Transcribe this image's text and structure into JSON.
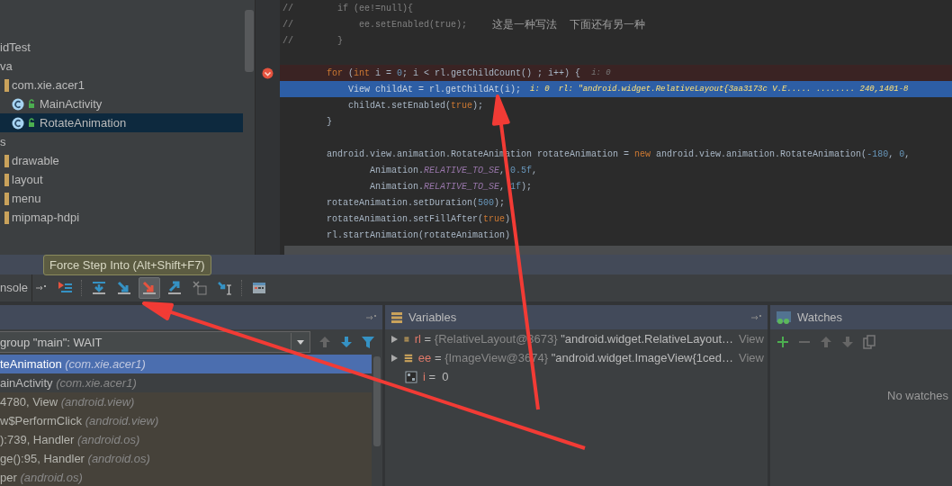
{
  "project_tree": [
    {
      "label": "idTest",
      "selected": false
    },
    {
      "label": "va",
      "selected": false,
      "children": [
        {
          "label": "com.xie.acer1",
          "kind": "folder",
          "selected": false,
          "children": [
            {
              "label": "MainActivity",
              "kind": "class",
              "selected": false
            },
            {
              "label": "RotateAnimation",
              "kind": "class",
              "selected": true
            }
          ]
        }
      ]
    },
    {
      "label": "s",
      "selected": false,
      "children": [
        {
          "label": "drawable",
          "kind": "folder",
          "selected": false
        },
        {
          "label": "layout",
          "kind": "folder",
          "selected": false
        },
        {
          "label": "menu",
          "kind": "folder",
          "selected": false
        },
        {
          "label": "mipmap-hdpi",
          "kind": "folder",
          "selected": false
        }
      ]
    }
  ],
  "editor": {
    "lines": [
      {
        "kind": "code",
        "prefix": "//",
        "breakpoint": false,
        "execution_point": false,
        "segments": [
          {
            "text": "  if (ee!=null){",
            "kind": "comment"
          }
        ]
      },
      {
        "kind": "code",
        "prefix": "//",
        "breakpoint": false,
        "execution_point": false,
        "segments": [
          {
            "text": "      ee.setEnabled(true);",
            "kind": "comment"
          },
          {
            "text": "这是一种写法",
            "kind": "note"
          },
          {
            "text": "下面还有另一种",
            "kind": "note"
          }
        ]
      },
      {
        "kind": "code",
        "prefix": "//",
        "breakpoint": false,
        "execution_point": false,
        "segments": [
          {
            "text": "  }",
            "kind": "comment"
          }
        ]
      },
      {
        "kind": "blank"
      },
      {
        "kind": "code",
        "breakpoint": true,
        "execution_point": false,
        "segments": [
          {
            "text": "for",
            "kind": "keyword"
          },
          {
            "text": " (",
            "kind": "plain"
          },
          {
            "text": "int",
            "kind": "keyword"
          },
          {
            "text": " i = ",
            "kind": "plain"
          },
          {
            "text": "0",
            "kind": "number"
          },
          {
            "text": "; i < rl.getChildCount() ; i++) {",
            "kind": "plain"
          },
          {
            "text": "i: 0",
            "kind": "hint"
          }
        ]
      },
      {
        "kind": "code",
        "breakpoint": false,
        "execution_point": true,
        "segments": [
          {
            "text": "    View childAt = rl.getChildAt(i);",
            "kind": "plain"
          },
          {
            "text": "i: 0",
            "kind": "hint"
          },
          {
            "text": "rl: \"android.widget.RelativeLayout{3aa3173c V.E..... ........ 240,1401-8",
            "kind": "hint"
          }
        ]
      },
      {
        "kind": "code",
        "breakpoint": false,
        "execution_point": false,
        "segments": [
          {
            "text": "    childAt.setEnabled(",
            "kind": "plain"
          },
          {
            "text": "true",
            "kind": "keyword"
          },
          {
            "text": ");",
            "kind": "plain"
          }
        ]
      },
      {
        "kind": "code",
        "breakpoint": false,
        "execution_point": false,
        "segments": [
          {
            "text": "}",
            "kind": "plain"
          }
        ]
      },
      {
        "kind": "blank"
      },
      {
        "kind": "code",
        "breakpoint": false,
        "execution_point": false,
        "segments": [
          {
            "text": "android.view.animation.RotateAnimation rotateAnimation = ",
            "kind": "plain"
          },
          {
            "text": "new",
            "kind": "keyword"
          },
          {
            "text": " android.view.animation.RotateAnimation(",
            "kind": "plain"
          },
          {
            "text": "-180",
            "kind": "number"
          },
          {
            "text": ", ",
            "kind": "plain"
          },
          {
            "text": "0",
            "kind": "number"
          },
          {
            "text": ",",
            "kind": "plain"
          }
        ]
      },
      {
        "kind": "code",
        "breakpoint": false,
        "execution_point": false,
        "segments": [
          {
            "text": "        Animation.",
            "kind": "plain"
          },
          {
            "text": "RELATIVE_TO_SE",
            "kind": "const"
          },
          {
            "text": ", ",
            "kind": "plain"
          },
          {
            "text": "0.5f",
            "kind": "number"
          },
          {
            "text": ",",
            "kind": "plain"
          }
        ]
      },
      {
        "kind": "code",
        "breakpoint": false,
        "execution_point": false,
        "segments": [
          {
            "text": "        Animation.",
            "kind": "plain"
          },
          {
            "text": "RELATIVE_TO_SE",
            "kind": "const"
          },
          {
            "text": ", ",
            "kind": "plain"
          },
          {
            "text": "1f",
            "kind": "number"
          },
          {
            "text": ");",
            "kind": "plain"
          }
        ]
      },
      {
        "kind": "code",
        "breakpoint": false,
        "execution_point": false,
        "segments": [
          {
            "text": "rotateAnimation.setDuration(",
            "kind": "plain"
          },
          {
            "text": "500",
            "kind": "number"
          },
          {
            "text": ");",
            "kind": "plain"
          }
        ]
      },
      {
        "kind": "code",
        "breakpoint": false,
        "execution_point": false,
        "segments": [
          {
            "text": "rotateAnimation.setFillAfter(",
            "kind": "plain"
          },
          {
            "text": "true",
            "kind": "keyword"
          },
          {
            "text": ")",
            "kind": "plain"
          }
        ]
      },
      {
        "kind": "code",
        "breakpoint": false,
        "execution_point": false,
        "segments": [
          {
            "text": "rl.startAnimation(rotateAnimation)",
            "kind": "plain"
          }
        ]
      }
    ]
  },
  "tooltip": "Force Step Into (Alt+Shift+F7)",
  "debug_toolbar": {
    "tab": "nsole",
    "buttons": [
      {
        "kind": "show-execution-point",
        "pressed": false
      },
      {
        "kind": "step-over",
        "pressed": false
      },
      {
        "kind": "step-into",
        "pressed": false
      },
      {
        "kind": "force-step-into",
        "pressed": true
      },
      {
        "kind": "step-out",
        "pressed": false
      },
      {
        "kind": "drop-frame",
        "pressed": false
      },
      {
        "kind": "run-to-cursor",
        "pressed": false
      },
      {
        "kind": "evaluate",
        "pressed": false
      }
    ]
  },
  "frames": {
    "thread": "group \"main\": WAIT",
    "items": [
      {
        "method": "teAnimation",
        "package": "(com.xie.acer1)",
        "selected": true,
        "library": false
      },
      {
        "method": "ainActivity",
        "package": "(com.xie.acer1)",
        "selected": false,
        "library": false
      },
      {
        "method": "4780, View",
        "package": "(android.view)",
        "selected": false,
        "library": true
      },
      {
        "method": "w$PerformClick",
        "package": "(android.view)",
        "selected": false,
        "library": true
      },
      {
        "method": "):739, Handler",
        "package": "(android.os)",
        "selected": false,
        "library": true
      },
      {
        "method": "ge():95, Handler",
        "package": "(android.os)",
        "selected": false,
        "library": true
      },
      {
        "method": "per",
        "package": "(android.os)",
        "selected": false,
        "library": true
      }
    ]
  },
  "variables": {
    "title": "Variables",
    "items": [
      {
        "kind": "object",
        "expandable": true,
        "name": "rl",
        "operator": "=",
        "type": "{RelativeLayout@3673}",
        "value": "\"android.widget.RelativeLayout…",
        "suffix": "View"
      },
      {
        "kind": "object",
        "expandable": true,
        "name": "ee",
        "operator": "=",
        "type": "{ImageView@3674}",
        "value": "\"android.widget.ImageView{1ced…",
        "suffix": "View"
      },
      {
        "kind": "primitive",
        "expandable": false,
        "name": "i",
        "operator": "=",
        "value": "0"
      }
    ]
  },
  "watches": {
    "title": "Watches",
    "empty_text": "No watches"
  }
}
